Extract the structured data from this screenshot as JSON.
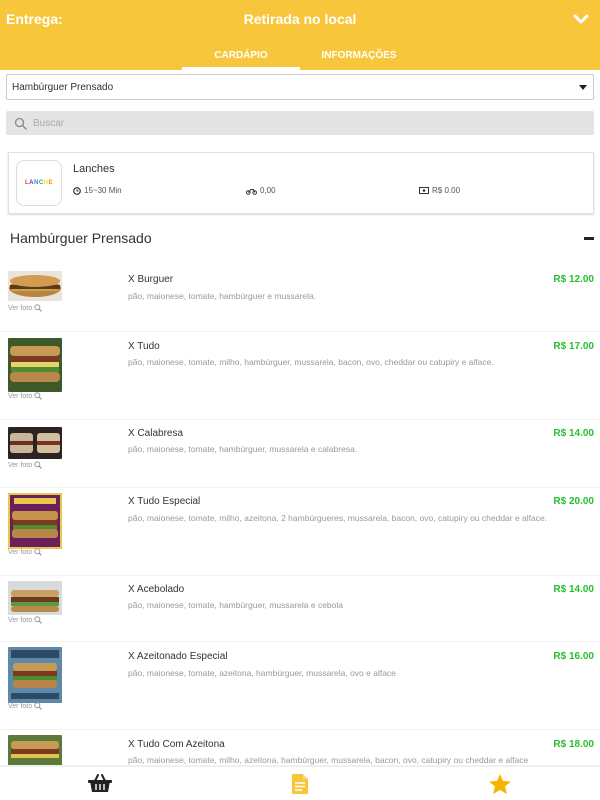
{
  "header": {
    "delivery_label": "Entrega:",
    "pickup_label": "Retirada no local",
    "tabs": [
      {
        "label": "CARDÁPIO",
        "active": true
      },
      {
        "label": "INFORMAÇÕES",
        "active": false
      }
    ]
  },
  "category_select": {
    "value": "Hambúrguer Prensado"
  },
  "search": {
    "placeholder": "Buscar",
    "icon": "search-icon"
  },
  "store": {
    "name": "Lanches",
    "time": "15~30 Min",
    "delivery_fee": "0,00",
    "min_order": "R$ 0.00"
  },
  "section": {
    "title": "Hambúrguer Prensado"
  },
  "see_photo_label": "Ver foto",
  "products": [
    {
      "name": "X Burguer",
      "description": "pão, maionese, tomate, hambúrguer e mussarela.",
      "price": "R$ 12.00"
    },
    {
      "name": "X Tudo",
      "description": "pão, maionese, tomate, milho, hambúrguer, mussarela, bacon, ovo, cheddar ou catupiry e alface.",
      "price": "R$ 17.00"
    },
    {
      "name": "X Calabresa",
      "description": "pão, maionese, tomate, hambúrguer, mussarela e calabresa.",
      "price": "R$ 14.00"
    },
    {
      "name": "X Tudo Especial",
      "description": "pão, maionese, tomate, milho, azeitona, 2 hambúrgueres, mussarela, bacon, ovo, catupiry ou cheddar e alface.",
      "price": "R$ 20.00"
    },
    {
      "name": "X Acebolado",
      "description": "pão, maionese, tomate, hambúrguer, mussarela e cebola",
      "price": "R$ 14.00"
    },
    {
      "name": "X Azeitonado Especial",
      "description": "pão, maionese, tomate, azeitona, hambúrguer, mussarela, ovo e alface",
      "price": "R$ 16.00"
    },
    {
      "name": "X Tudo Com Azeitona",
      "description": "pão, maionese, tomate, milho, azeitona, hambúrguer, mussarela, bacon, ovo, catupiry ou cheddar e alface",
      "price": "R$ 18.00"
    }
  ],
  "bottom_nav": [
    {
      "icon": "basket-icon"
    },
    {
      "icon": "document-icon"
    },
    {
      "icon": "star-icon"
    }
  ],
  "colors": {
    "brand": "#f7c63b",
    "price": "#25c02e"
  }
}
